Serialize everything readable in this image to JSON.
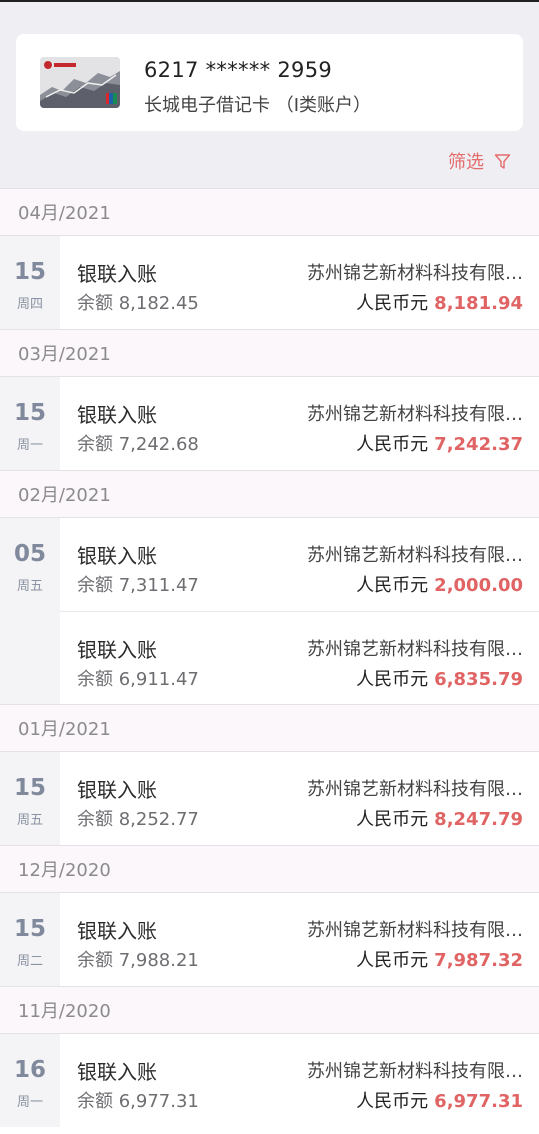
{
  "card": {
    "number": "6217 ****** 2959",
    "type": "长城电子借记卡 （I类账户）"
  },
  "filter_label": "筛选",
  "colors": {
    "accent": "#e06464",
    "header_bg": "#efeef2"
  },
  "months": [
    {
      "label": "04月/2021",
      "groups": [
        {
          "day": "15",
          "weekday": "周四",
          "tx": [
            {
              "title": "银联入账",
              "balance": "余额 8,182.45",
              "counterparty": "苏州锦艺新材料科技有限公司",
              "currency": "人民币元",
              "amount": "8,181.94"
            }
          ]
        }
      ]
    },
    {
      "label": "03月/2021",
      "groups": [
        {
          "day": "15",
          "weekday": "周一",
          "tx": [
            {
              "title": "银联入账",
              "balance": "余额 7,242.68",
              "counterparty": "苏州锦艺新材料科技有限公司",
              "currency": "人民币元",
              "amount": "7,242.37"
            }
          ]
        }
      ]
    },
    {
      "label": "02月/2021",
      "groups": [
        {
          "day": "05",
          "weekday": "周五",
          "tx": [
            {
              "title": "银联入账",
              "balance": "余额 7,311.47",
              "counterparty": "苏州锦艺新材料科技有限公司",
              "currency": "人民币元",
              "amount": "2,000.00"
            },
            {
              "title": "银联入账",
              "balance": "余额 6,911.47",
              "counterparty": "苏州锦艺新材料科技有限公司",
              "currency": "人民币元",
              "amount": "6,835.79"
            }
          ]
        }
      ]
    },
    {
      "label": "01月/2021",
      "groups": [
        {
          "day": "15",
          "weekday": "周五",
          "tx": [
            {
              "title": "银联入账",
              "balance": "余额 8,252.77",
              "counterparty": "苏州锦艺新材料科技有限公司",
              "currency": "人民币元",
              "amount": "8,247.79"
            }
          ]
        }
      ]
    },
    {
      "label": "12月/2020",
      "groups": [
        {
          "day": "15",
          "weekday": "周二",
          "tx": [
            {
              "title": "银联入账",
              "balance": "余额 7,988.21",
              "counterparty": "苏州锦艺新材料科技有限公司",
              "currency": "人民币元",
              "amount": "7,987.32"
            }
          ]
        }
      ]
    },
    {
      "label": "11月/2020",
      "groups": [
        {
          "day": "16",
          "weekday": "周一",
          "tx": [
            {
              "title": "银联入账",
              "balance": "余额 6,977.31",
              "counterparty": "苏州锦艺新材料科技有限公司",
              "currency": "人民币元",
              "amount": "6,977.31"
            }
          ]
        }
      ]
    }
  ]
}
